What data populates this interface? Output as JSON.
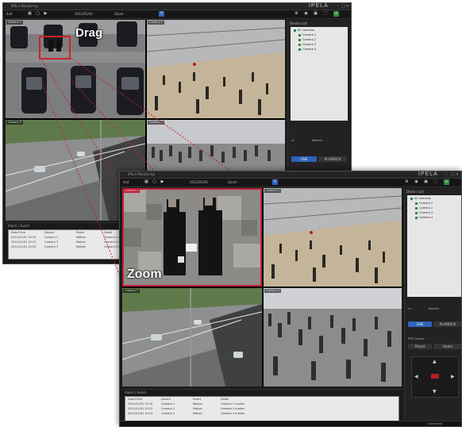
{
  "colors": {
    "accent": "#2f63b8",
    "zoom_border": "#c51f3b",
    "drag_box": "#d0202a",
    "device_ok": "#2e8a3a"
  },
  "window_back": {
    "title": "IPELA Monitoring",
    "brand": "IPELA",
    "toolbar": {
      "layout_label": "4x4",
      "time_label": "2011/01/01",
      "zoom_label": "Zoom"
    },
    "cameras": [
      {
        "label": "Camera 1",
        "scene": "parking-lot"
      },
      {
        "label": "Camera 2",
        "scene": "station-concourse"
      },
      {
        "label": "Camera 3",
        "scene": "highway"
      },
      {
        "label": "Camera 4",
        "scene": "crowd"
      }
    ],
    "device_panel": {
      "title": "Device List",
      "root": "All Cameras",
      "items": [
        "Camera 1",
        "Camera 2",
        "Camera 3",
        "Camera 4"
      ]
    },
    "playback": {
      "live": "LIVE",
      "playback": "PLAYBACK",
      "speed": "x1",
      "mode": "Normal"
    },
    "log": {
      "title": "Alarm / Event",
      "columns": [
        "Date/Time",
        "Device",
        "Event",
        "Detail"
      ],
      "rows": [
        [
          "2011/01/01 10:10",
          "Camera 1",
          "Motion",
          "Camera 1 motion"
        ],
        [
          "2011/01/01 10:12",
          "Camera 2",
          "Motion",
          "Camera 2 motion"
        ],
        [
          "2011/01/01 10:15",
          "Camera 3",
          "Motion",
          "Camera 3 motion"
        ]
      ]
    }
  },
  "window_front": {
    "title": "IPELA Monitoring",
    "brand": "IPELA",
    "toolbar": {
      "layout_label": "4x4",
      "time_label": "2011/01/01",
      "zoom_label": "Zoom"
    },
    "cameras": [
      {
        "label": "Camera 1",
        "scene": "zoomed-people"
      },
      {
        "label": "Camera 2",
        "scene": "station-concourse"
      },
      {
        "label": "Camera 3",
        "scene": "highway"
      },
      {
        "label": "Camera 4",
        "scene": "crowd"
      }
    ],
    "device_panel": {
      "title": "Device List",
      "root": "All Cameras",
      "items": [
        "Camera 1",
        "Camera 2",
        "Camera 3",
        "Camera 4"
      ]
    },
    "playback": {
      "live": "LIVE",
      "playback": "PLAYBACK",
      "speed": "x1",
      "mode": "Normal"
    },
    "ptz": {
      "title": "PTZ Control",
      "preset": "Preset",
      "home": "Home"
    },
    "log": {
      "title": "Alarm / Event",
      "columns": [
        "Date/Time",
        "Device",
        "Event",
        "Detail"
      ],
      "rows": [
        [
          "2011/01/01 10:10",
          "Camera 1",
          "Motion",
          "Camera 1 motion"
        ],
        [
          "2011/01/01 10:12",
          "Camera 2",
          "Motion",
          "Camera 2 motion"
        ],
        [
          "2011/01/01 10:15",
          "Camera 3",
          "Motion",
          "Camera 3 motion"
        ]
      ]
    },
    "status": "Connected"
  },
  "callouts": {
    "drag": "Drag",
    "zoom": "Zoom"
  }
}
